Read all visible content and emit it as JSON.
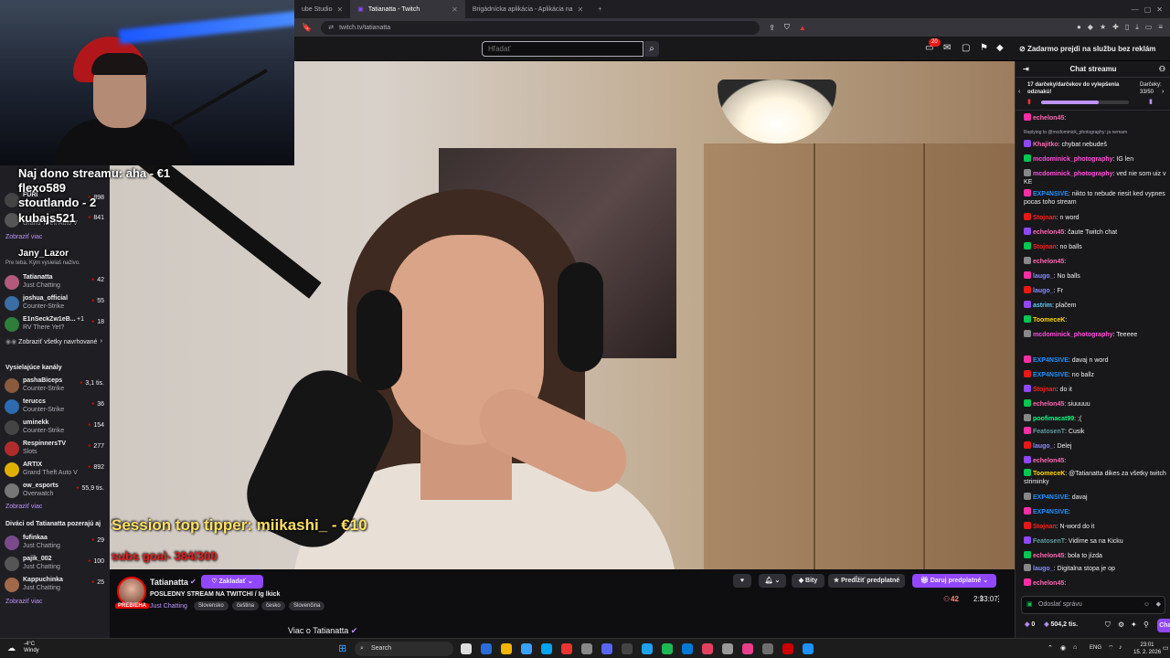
{
  "browser": {
    "tabs": [
      {
        "label": "ube Studio",
        "active": false
      },
      {
        "label": "Tatianatta - Twitch",
        "active": true
      },
      {
        "label": "Brigádnícka aplikácia - Aplikácia na",
        "active": false
      }
    ],
    "url": "twitch.tv/tatianatta"
  },
  "topnav": {
    "search_placeholder": "Hľadať",
    "notification_count": "20",
    "turbo_label": "Zadarmo prejdi na službu bez reklám"
  },
  "overlay": {
    "top_donation": "Naj dono streamu: aha - €1",
    "users": [
      "flexo589",
      "stoutlando - 2",
      "kubajs521"
    ],
    "extra_user": "Jany_Lazor",
    "session_tipper": "Session top tipper: miikashi_ - €10",
    "subs_goal": "subs goal- 384/300"
  },
  "sidebar": {
    "top_rows": [
      {
        "name": "FURI",
        "game": "Grand Theft Auto V",
        "viewers": "898"
      },
      {
        "name": "",
        "game": "Grand Theft Auto V",
        "viewers": "841"
      }
    ],
    "show_more_1": "Zobraziť viac",
    "recommend_note": "Pre teba. Kým vysielaš naživo.",
    "recommended": [
      {
        "name": "Tatianatta",
        "game": "Just Chatting",
        "viewers": "42",
        "color": "#b35a7a"
      },
      {
        "name": "joshua_official",
        "game": "Counter-Strike",
        "viewers": "55",
        "color": "#3a6ea5"
      },
      {
        "name": "E1nSeckZw1eB...",
        "game": "RV There Yet?",
        "viewers": "18",
        "extra": "+1",
        "color": "#2f7d3a"
      }
    ],
    "show_all_recommended": "Zobraziť všetky navrhované",
    "live_heading": "Vysielajúce kanály",
    "live_channels": [
      {
        "name": "pashaBiceps",
        "game": "Counter-Strike",
        "viewers": "3,1 tis.",
        "color": "#8a5a3c"
      },
      {
        "name": "teruccs",
        "game": "Counter-Strike",
        "viewers": "36",
        "color": "#2c6bb0"
      },
      {
        "name": "uminekk",
        "game": "Counter-Strike",
        "viewers": "154",
        "color": "#444"
      },
      {
        "name": "RespinnersTV",
        "game": "Slots",
        "viewers": "277",
        "color": "#b02c2c"
      },
      {
        "name": "ARTIX",
        "game": "Grand Theft Auto V",
        "viewers": "892",
        "color": "#e0b000"
      },
      {
        "name": "ow_esports",
        "game": "Overwatch",
        "viewers": "55,9 tis.",
        "color": "#777"
      }
    ],
    "show_more_2": "Zobraziť viac",
    "viewers_heading": "Diváci od Tatianatta pozerajú aj",
    "viewers_channels": [
      {
        "name": "fufinkaa",
        "game": "Just Chatting",
        "viewers": "29",
        "color": "#7a4a8a"
      },
      {
        "name": "pajik_002",
        "game": "Just Chatting",
        "viewers": "100",
        "color": "#555"
      },
      {
        "name": "Kappuchinka",
        "game": "Just Chatting",
        "viewers": "25",
        "color": "#a06a4a"
      }
    ],
    "show_more_3": "Zobraziť viac"
  },
  "stream": {
    "channel": "Tatianatta",
    "follow_label": "Zakladať",
    "live_badge": "PREBIEHA",
    "title": "POSLEDNY STREAM NA TWITCHI / Ig lkick",
    "category": "Just Chatting",
    "tags": [
      "Slovensko",
      "čeština",
      "česko",
      "Slovenčina"
    ],
    "bits_label": "Bity",
    "prolong_label": "Predĺžiť predplatné",
    "gift_label": "Daruj predplatné",
    "viewers": "42",
    "uptime": "2:33:07",
    "about": "Viac o Tatianatta"
  },
  "chat": {
    "header": "Chat streamu",
    "gift_banner": "17 darčeky/darčekov do vylepšenia odznakú!",
    "gift_count": "Darčeky: 33/50",
    "gift_progress": 0.66,
    "messages": [
      {
        "user": "echelon45",
        "text": ":",
        "color": "#ff69b4"
      },
      {
        "user": "",
        "text": "Replying to @mcdominick_photography: ja nemam",
        "color": "#adadb8"
      },
      {
        "user": "Khajitko",
        "text": ": chybat nebudeš",
        "color": "#ff69b4"
      },
      {
        "user": "mcdominick_photography",
        "text": ": IG len",
        "color": "#ff4fd8"
      },
      {
        "user": "mcdominick_photography",
        "text": ": ved nie som uiz v KE",
        "color": "#ff4fd8"
      },
      {
        "user": "EXP4NSIVE",
        "text": ": nikto to nebude riesit ked vypnes pocas toho stream",
        "color": "#1e90ff"
      },
      {
        "user": "Stojnan",
        "text": ": n word",
        "color": "#ff2020"
      },
      {
        "user": "echelon45",
        "text": ": čaute Twitch chat",
        "color": "#ff69b4"
      },
      {
        "user": "Stojnan",
        "text": ": no balls",
        "color": "#ff2020"
      },
      {
        "user": "echelon45",
        "text": ":",
        "color": "#ff69b4"
      },
      {
        "user": "laugo_",
        "text": ": No balls",
        "color": "#8a8aff"
      },
      {
        "user": "laugo_",
        "text": ": Fr",
        "color": "#8a8aff"
      },
      {
        "user": "astrim",
        "text": ": plačem",
        "color": "#5acdff"
      },
      {
        "user": "ToomeceK",
        "text": ":",
        "color": "#ffd700"
      },
      {
        "user": "mcdominick_photography",
        "text": ": Teeeee",
        "color": "#ff4fd8"
      },
      {
        "user": "EXP4NSIVE",
        "text": ": davaj n word",
        "color": "#1e90ff"
      },
      {
        "user": "EXP4NSIVE",
        "text": ": no ballz",
        "color": "#1e90ff"
      },
      {
        "user": "Stojnan",
        "text": ": do it",
        "color": "#ff2020"
      },
      {
        "user": "echelon45",
        "text": ": siuuuuu",
        "color": "#ff69b4"
      },
      {
        "user": "poofimacat99",
        "text": ": ;(",
        "color": "#00ff7f"
      },
      {
        "user": "FeatosenT",
        "text": ": Cusik",
        "color": "#5f9ea0"
      },
      {
        "user": "laugo_",
        "text": ": Delej",
        "color": "#8a8aff"
      },
      {
        "user": "echelon45",
        "text": ":",
        "color": "#ff69b4"
      },
      {
        "user": "ToomeceK",
        "text": ": @Tatianatta dikes za všetky twitch striminky",
        "color": "#ffd700"
      },
      {
        "user": "EXP4NSIVE",
        "text": ": davaj",
        "color": "#1e90ff"
      },
      {
        "user": "EXP4NSIVE",
        "text": ":",
        "color": "#1e90ff"
      },
      {
        "user": "Stojnan",
        "text": ": N-word do it",
        "color": "#ff2020"
      },
      {
        "user": "FeatosenT",
        "text": ": Vidíme sa na Kicku",
        "color": "#5f9ea0"
      },
      {
        "user": "echelon45",
        "text": ": bola to jízda",
        "color": "#ff69b4"
      },
      {
        "user": "laugo_",
        "text": ": Digitalna stopa je op",
        "color": "#8a8aff"
      },
      {
        "user": "echelon45",
        "text": ":",
        "color": "#ff69b4"
      }
    ],
    "input_placeholder": "Odoslať správu",
    "points": "0",
    "points_value": "504,2 tis.",
    "send_label": "Chat"
  },
  "taskbar": {
    "weather_temp": "-4°C",
    "weather_desc": "Windy",
    "search_label": "Search",
    "language": "ENG",
    "time": "23:01",
    "date": "15. 2. 2026"
  }
}
